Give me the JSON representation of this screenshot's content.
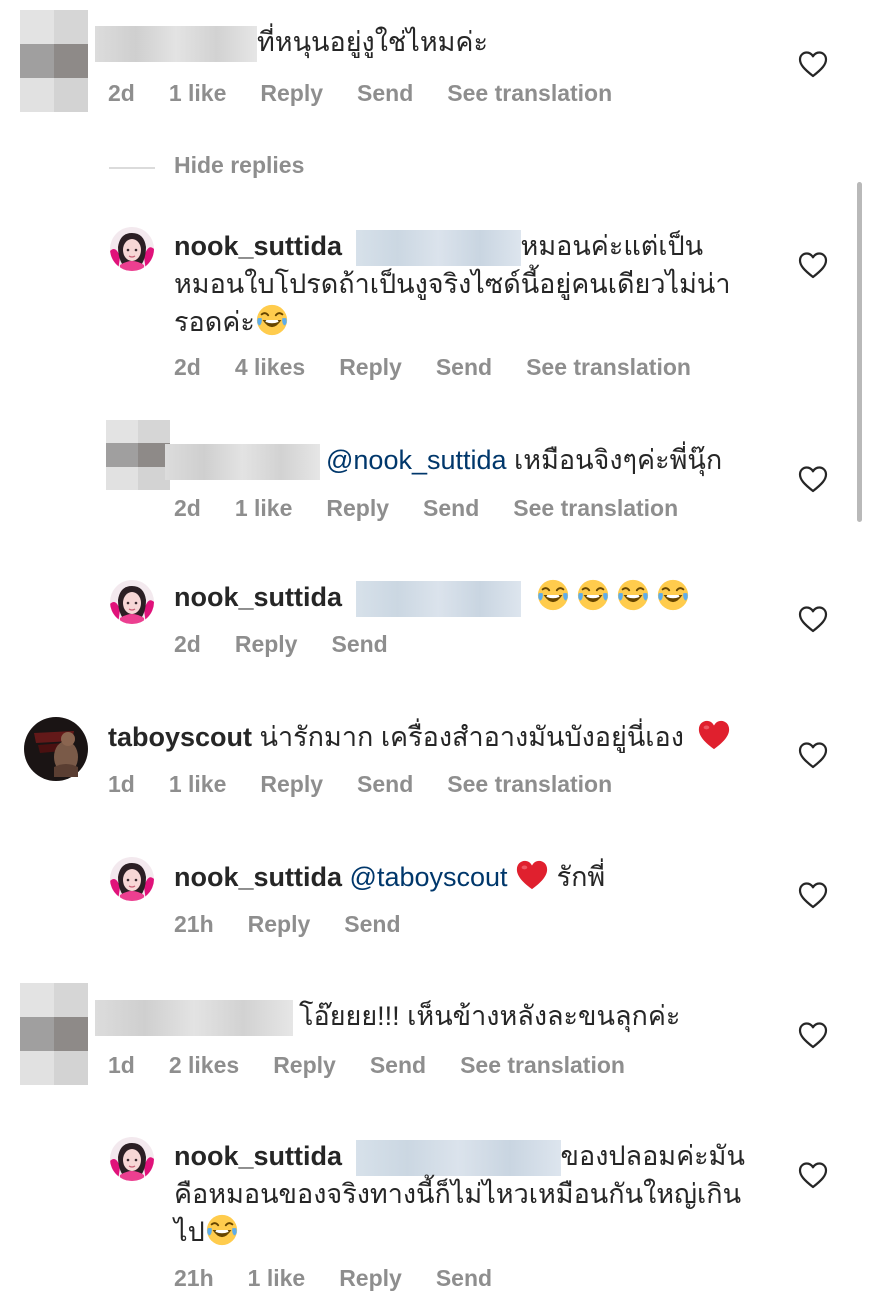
{
  "comments": [
    {
      "text": "ที่หนุนอยู่งูใช่ไหมค่ะ",
      "time": "2d",
      "likes": "1 like",
      "reply": "Reply",
      "send": "Send",
      "translate": "See translation"
    },
    {
      "hide_replies": "Hide replies"
    },
    {
      "user": "nook_suttida",
      "line1": "หมอนค่ะแต่เป็น",
      "line2": "หมอนใบโปรดถ้าเป็นงูจริงไซด์นี้อยู่คนเดียวไม่น่า",
      "line3": "รอดค่ะ",
      "time": "2d",
      "likes": "4 likes",
      "reply": "Reply",
      "send": "Send",
      "translate": "See translation"
    },
    {
      "mention": "@nook_suttida",
      "text": "เหมือนจิงๆค่ะพี่นุ๊ก",
      "time": "2d",
      "likes": "1 like",
      "reply": "Reply",
      "send": "Send",
      "translate": "See translation"
    },
    {
      "user": "nook_suttida",
      "time": "2d",
      "reply": "Reply",
      "send": "Send"
    },
    {
      "user": "taboyscout",
      "text": "น่ารักมาก เครื่องสำอางมันบังอยู่นี่เอง",
      "time": "1d",
      "likes": "1 like",
      "reply": "Reply",
      "send": "Send",
      "translate": "See translation"
    },
    {
      "user": "nook_suttida",
      "mention": "@taboyscout",
      "text": "รักพี่",
      "time": "21h",
      "reply": "Reply",
      "send": "Send"
    },
    {
      "text": "โอ๊ยยย!!! เห็นข้างหลังละขนลุกค่ะ",
      "time": "1d",
      "likes": "2 likes",
      "reply": "Reply",
      "send": "Send",
      "translate": "See translation"
    },
    {
      "user": "nook_suttida",
      "line1": "ของปลอมค่ะมัน",
      "line2": "คือหมอนของจริงทางนี้ก็ไม่ไหวเหมือนกันใหญ่เกิน",
      "line3": "ไป",
      "time": "21h",
      "likes": "1 like",
      "reply": "Reply",
      "send": "Send"
    }
  ],
  "colors": {
    "accent_mention": "#00376b",
    "meta_gray": "#8e8e8e",
    "heart_red": "#e0202e"
  },
  "icons": [
    "heart-outline-icon",
    "laughing-emoji-icon",
    "red-heart-emoji-icon"
  ]
}
